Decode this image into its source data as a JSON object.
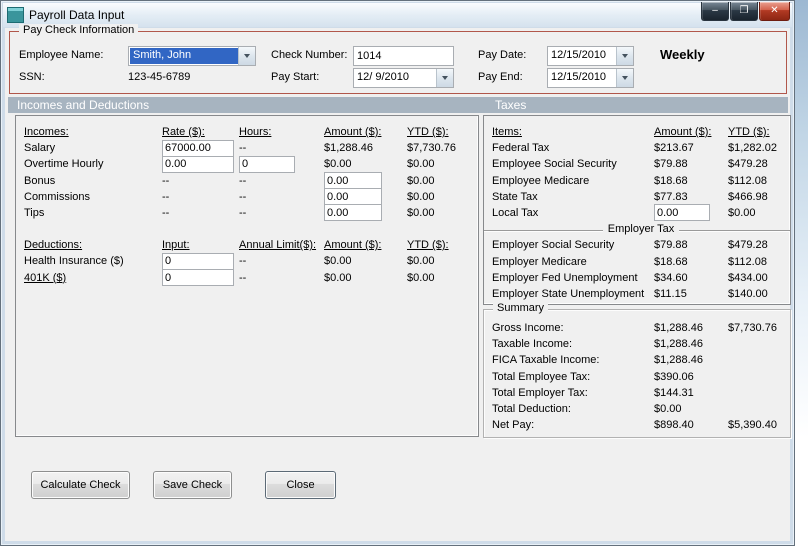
{
  "window": {
    "title": "Payroll Data Input",
    "minimize_glyph": "–",
    "maximize_glyph": "❐",
    "close_glyph": "✕"
  },
  "paycheck": {
    "group_label": "Pay Check Information",
    "employee_name": {
      "label": "Employee Name:",
      "value": "Smith, John"
    },
    "ssn": {
      "label": "SSN:",
      "value": "123-45-6789"
    },
    "check_number": {
      "label": "Check Number:",
      "value": "1014"
    },
    "pay_start": {
      "label": "Pay Start:",
      "value": "12/ 9/2010"
    },
    "pay_date": {
      "label": "Pay Date:",
      "value": "12/15/2010"
    },
    "pay_end": {
      "label": "Pay End:",
      "value": "12/15/2010"
    },
    "frequency": "Weekly"
  },
  "section_band": {
    "left": "Incomes and Deductions",
    "right": "Taxes"
  },
  "incomes": {
    "headers": {
      "name": "Incomes:",
      "rate": "Rate ($):",
      "hours": "Hours:",
      "amount": "Amount ($):",
      "ytd": "YTD ($):"
    },
    "rows": [
      {
        "name": "Salary",
        "rate": "67000.00",
        "hours": "--",
        "amount": "$1,288.46",
        "ytd": "$7,730.76"
      },
      {
        "name": "Overtime Hourly",
        "rate": "0.00",
        "hours": "0",
        "amount": "$0.00",
        "ytd": "$0.00"
      },
      {
        "name": "Bonus",
        "rate": "--",
        "hours": "--",
        "amount": "0.00",
        "ytd": "$0.00"
      },
      {
        "name": "Commissions",
        "rate": "--",
        "hours": "--",
        "amount": "0.00",
        "ytd": "$0.00"
      },
      {
        "name": "Tips",
        "rate": "--",
        "hours": "--",
        "amount": "0.00",
        "ytd": "$0.00"
      }
    ]
  },
  "deductions": {
    "headers": {
      "name": "Deductions:",
      "input": "Input:",
      "limit": "Annual Limit($):",
      "amount": "Amount ($):",
      "ytd": "YTD ($):"
    },
    "rows": [
      {
        "name": "Health Insurance  ($)",
        "input": "0",
        "limit": "--",
        "amount": "$0.00",
        "ytd": "$0.00"
      },
      {
        "name": "401K  ($)",
        "input": "0",
        "limit": "--",
        "amount": "$0.00",
        "ytd": "$0.00"
      }
    ]
  },
  "taxes": {
    "headers": {
      "name": "Items:",
      "amount": "Amount ($):",
      "ytd": "YTD ($):"
    },
    "employee_rows": [
      {
        "name": "Federal Tax",
        "amount": "$213.67",
        "ytd": "$1,282.02"
      },
      {
        "name": "Employee Social Security",
        "amount": "$79.88",
        "ytd": "$479.28"
      },
      {
        "name": "Employee Medicare",
        "amount": "$18.68",
        "ytd": "$112.08"
      },
      {
        "name": "State Tax",
        "amount": "$77.83",
        "ytd": "$466.98"
      },
      {
        "name": "Local Tax",
        "amount": "0.00",
        "ytd": "$0.00"
      }
    ],
    "employer_divider": "Employer Tax",
    "employer_rows": [
      {
        "name": "Employer Social Security",
        "amount": "$79.88",
        "ytd": "$479.28"
      },
      {
        "name": "Employer Medicare",
        "amount": "$18.68",
        "ytd": "$112.08"
      },
      {
        "name": "Employer Fed Unemployment",
        "amount": "$34.60",
        "ytd": "$434.00"
      },
      {
        "name": "Employer State Unemployment",
        "amount": "$11.15",
        "ytd": "$140.00"
      }
    ]
  },
  "summary": {
    "group_label": "Summary",
    "rows": [
      {
        "label": "Gross Income:",
        "amount": "$1,288.46",
        "ytd": "$7,730.76"
      },
      {
        "label": "Taxable Income:",
        "amount": "$1,288.46",
        "ytd": ""
      },
      {
        "label": "FICA Taxable Income:",
        "amount": "$1,288.46",
        "ytd": ""
      },
      {
        "label": "Total Employee Tax:",
        "amount": "$390.06",
        "ytd": ""
      },
      {
        "label": "Total Employer Tax:",
        "amount": "$144.31",
        "ytd": ""
      },
      {
        "label": "Total Deduction:",
        "amount": "$0.00",
        "ytd": ""
      },
      {
        "label": "Net Pay:",
        "amount": "$898.40",
        "ytd": "$5,390.40"
      }
    ]
  },
  "buttons": {
    "calculate": "Calculate Check",
    "save": "Save Check",
    "close": "Close"
  }
}
